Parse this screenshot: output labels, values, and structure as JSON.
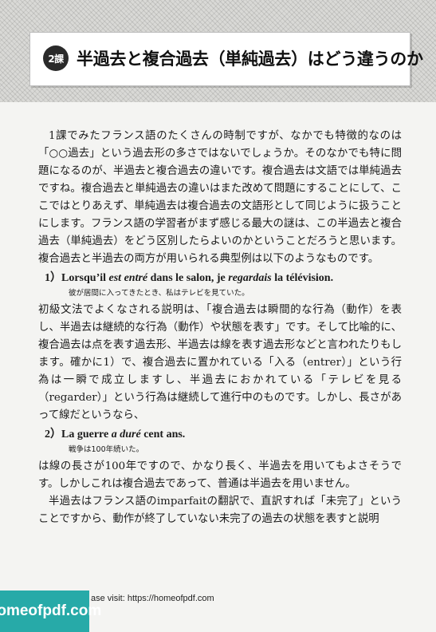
{
  "header": {
    "badge": "2課",
    "title": "半過去と複合過去（単純過去）はどう違うのか"
  },
  "paragraphs": {
    "p1": "1課でみたフランス語のたくさんの時制ですが、なかでも特徴的なのは「○○過去」という過去形の多さではないでしょうか。そのなかでも特に問題になるのが、半過去と複合過去の違いです。複合過去は文語では単純過去ですね。複合過去と単純過去の違いはまた改めて問題にすることにして、ここではとりあえず、単純過去は複合過去の文語形として同じように扱うことにします。フランス語の学習者がまず感じる最大の謎は、この半過去と複合過去（単純過去）をどう区別したらよいのかということだろうと思います。複合過去と半過去の両方が用いられる典型例は以下のようなものです。",
    "p2": "初級文法でよくなされる説明は、「複合過去は瞬間的な行為（動作）を表し、半過去は継続的な行為（動作）や状態を表す」です。そして比喩的に、複合過去は点を表す過去形、半過去は線を表す過去形などと言われたりもします。確かに1）で、複合過去に置かれている「入る（entrer）」という行為は一瞬で成立しますし、半過去におかれている「テレビを見る（regarder）」という行為は継続して進行中のものです。しかし、長さがあって線だというなら、",
    "p3": "は線の長さが100年ですので、かなり長く、半過去を用いてもよさそうです。しかしこれは複合過去であって、普通は半過去を用いません。",
    "p4": "半過去はフランス語のimparfaitの翻訳で、直訳すれば「未完了」ということですから、動作が終了していない未完了の過去の状態を表すと説明"
  },
  "examples": {
    "ex1": {
      "num": "1）",
      "part1": "Lorsqu’il ",
      "part2": "est entré",
      "part3": " dans le salon, je ",
      "part4": "regardais",
      "part5": " la télévision.",
      "translation": "彼が居間に入ってきたとき、私はテレビを見ていた。"
    },
    "ex2": {
      "num": "2）",
      "part1": "La guerre ",
      "part2": "a duré",
      "part3": " cent ans.",
      "translation": "戦争は100年続いた。"
    }
  },
  "watermark": {
    "logo": "homeofpdf.com",
    "text": "ase visit: https://homeofpdf.com"
  }
}
